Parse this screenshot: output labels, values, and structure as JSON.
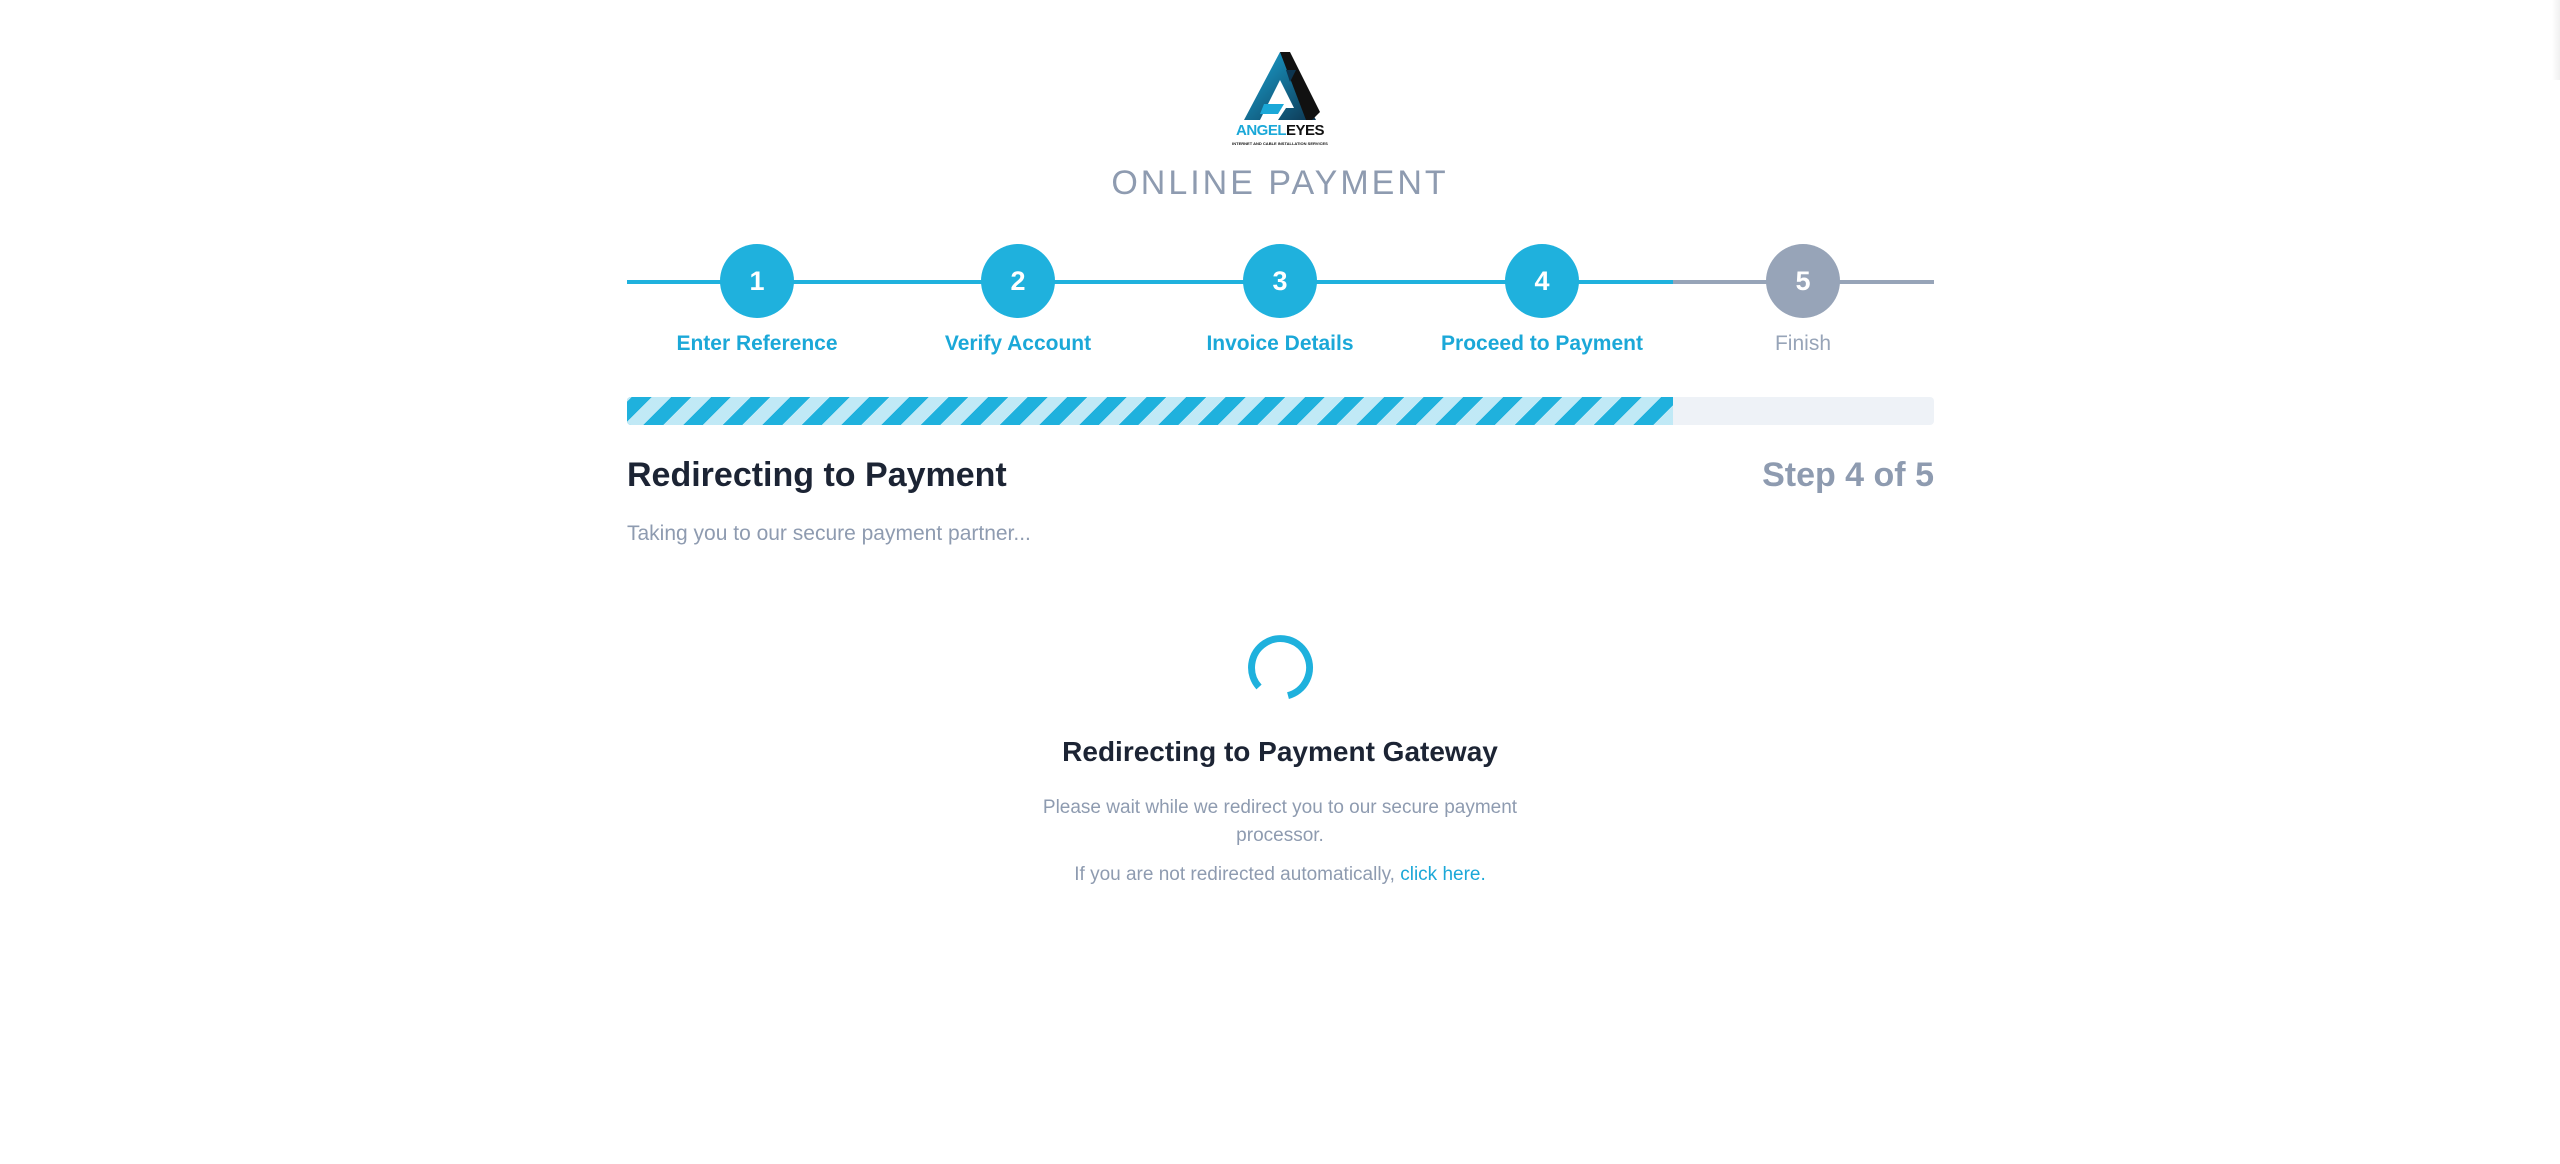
{
  "brand": {
    "name_part1": "ANGEL",
    "name_part2": "EYES",
    "tagline": "INTERNET AND CABLE INSTALLATION SERVICES",
    "primary_color": "#1fb1dd",
    "muted_color": "#97a4b8"
  },
  "header": {
    "title": "ONLINE PAYMENT"
  },
  "stepper": {
    "steps": [
      {
        "number": "1",
        "label": "Enter Reference",
        "state": "active"
      },
      {
        "number": "2",
        "label": "Verify Account",
        "state": "active"
      },
      {
        "number": "3",
        "label": "Invoice Details",
        "state": "active"
      },
      {
        "number": "4",
        "label": "Proceed to Payment",
        "state": "active"
      },
      {
        "number": "5",
        "label": "Finish",
        "state": "pending"
      }
    ]
  },
  "progress": {
    "fraction": 0.8
  },
  "section": {
    "title": "Redirecting to Payment",
    "step_counter": "Step 4 of 5",
    "subtitle": "Taking you to our secure payment partner..."
  },
  "redirect": {
    "title": "Redirecting to Payment Gateway",
    "message": "Please wait while we redirect you to our secure payment processor.",
    "fallback_text": "If you are not redirected automatically, ",
    "fallback_link": "click here."
  }
}
